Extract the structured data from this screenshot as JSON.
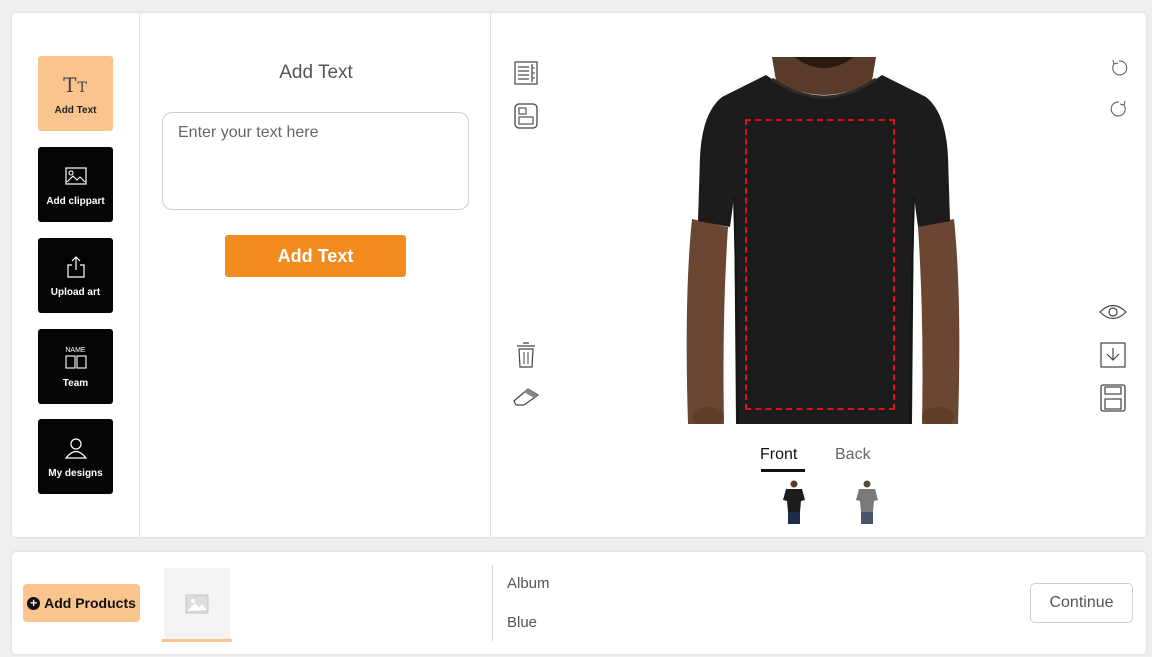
{
  "tools": [
    {
      "label": "Add Text",
      "icon": "text-size-icon",
      "glyph": "TT",
      "active": true
    },
    {
      "label": "Add clippart",
      "icon": "image-icon",
      "active": false
    },
    {
      "label": "Upload art",
      "icon": "upload-icon",
      "active": false
    },
    {
      "label": "Team",
      "icon": "team-name-icon",
      "glyph": "NAME",
      "active": false
    },
    {
      "label": "My designs",
      "icon": "user-icon",
      "active": false
    }
  ],
  "text_panel": {
    "title": "Add Text",
    "placeholder": "Enter your text here",
    "value": "",
    "button_label": "Add Text"
  },
  "design": {
    "left_icons": [
      "align-icon",
      "layout-icon",
      "trash-icon",
      "eraser-icon"
    ],
    "right_icons": [
      "undo-icon",
      "redo-icon",
      "preview-eye-icon",
      "download-icon",
      "save-icon"
    ],
    "views": [
      {
        "label": "Front",
        "active": true
      },
      {
        "label": "Back",
        "active": false
      }
    ],
    "print_area_color": "#e0101a",
    "shirt_color": "#1c1c1c"
  },
  "bottom_bar": {
    "add_products_label": "Add Products",
    "product_name": "Album",
    "product_color": "Blue",
    "continue_label": "Continue"
  },
  "colors": {
    "accent": "#f28c1e",
    "accent_light": "#f9c58d",
    "tool_bg": "#050505"
  }
}
